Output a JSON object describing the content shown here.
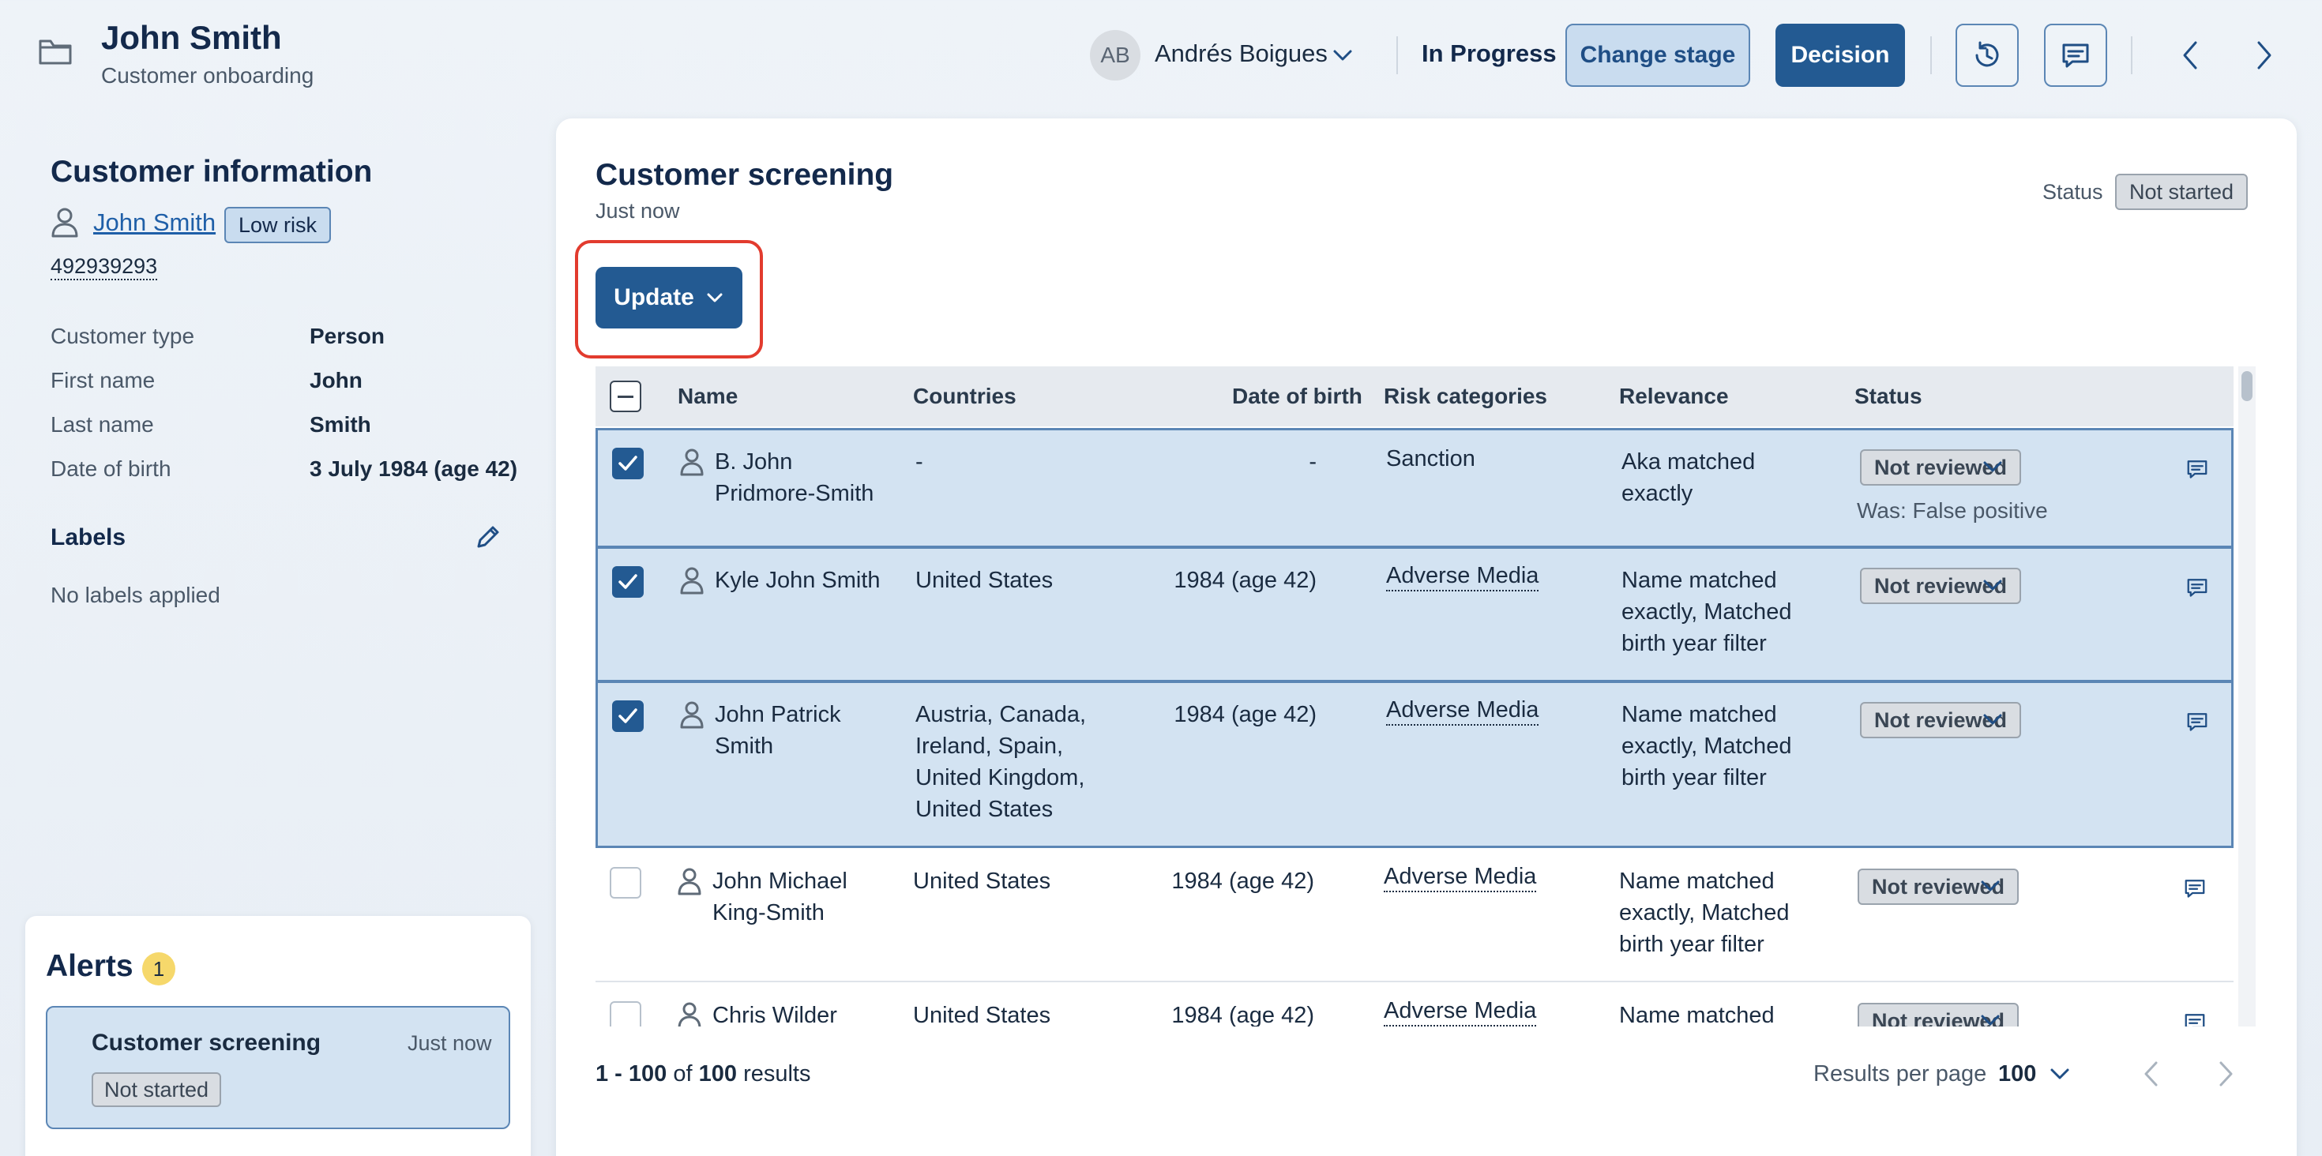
{
  "header": {
    "title": "John Smith",
    "subtitle": "Customer onboarding",
    "assignee_initials": "AB",
    "assignee_name": "Andrés Boigues",
    "stage": "In Progress",
    "change_stage_label": "Change stage",
    "decision_label": "Decision"
  },
  "customer": {
    "section_title": "Customer information",
    "name": "John Smith",
    "risk": "Low risk",
    "id": "492939293",
    "fields": [
      {
        "label": "Customer type",
        "value": "Person"
      },
      {
        "label": "First name",
        "value": "John"
      },
      {
        "label": "Last name",
        "value": "Smith"
      },
      {
        "label": "Date of birth",
        "value": "3 July 1984 (age 42)"
      }
    ],
    "labels_title": "Labels",
    "labels_empty": "No labels applied"
  },
  "alerts": {
    "title": "Alerts",
    "count": "1",
    "item_title": "Customer screening",
    "item_time": "Just now",
    "item_status": "Not started"
  },
  "screening": {
    "title": "Customer screening",
    "time": "Just now",
    "status_label": "Status",
    "status_value": "Not started",
    "update_label": "Update"
  },
  "table": {
    "columns": {
      "name": "Name",
      "countries": "Countries",
      "dob": "Date of birth",
      "risk": "Risk categories",
      "relevance": "Relevance",
      "status": "Status"
    },
    "rows": [
      {
        "name1": "B. John",
        "name2": "Pridmore-Smith",
        "countries": [
          "-"
        ],
        "dob": "-",
        "risk": "Sanction",
        "relevance": [
          "Aka matched",
          "exactly"
        ],
        "status": "Not reviewed",
        "was": "Was: False positive"
      },
      {
        "name1": "Kyle John Smith",
        "name2": "",
        "countries": [
          "United States"
        ],
        "dob": "1984 (age 42)",
        "risk": "Adverse Media",
        "relevance": [
          "Name matched",
          "exactly, Matched",
          "birth year filter"
        ],
        "status": "Not reviewed",
        "was": ""
      },
      {
        "name1": "John Patrick",
        "name2": "Smith",
        "countries": [
          "Austria, Canada,",
          "Ireland, Spain,",
          "United Kingdom,",
          "United States"
        ],
        "dob": "1984 (age 42)",
        "risk": "Adverse Media",
        "relevance": [
          "Name matched",
          "exactly, Matched",
          "birth year filter"
        ],
        "status": "Not reviewed",
        "was": ""
      },
      {
        "name1": "John Michael",
        "name2": "King-Smith",
        "countries": [
          "United States"
        ],
        "dob": "1984 (age 42)",
        "risk": "Adverse Media",
        "relevance": [
          "Name matched",
          "exactly, Matched",
          "birth year filter"
        ],
        "status": "Not reviewed",
        "was": ""
      },
      {
        "name1": "Chris Wilder",
        "name2": "",
        "countries": [
          "United States"
        ],
        "dob": "1984 (age 42)",
        "risk": "Adverse Media",
        "relevance": [
          "Name matched"
        ],
        "status": "Not reviewed",
        "was": ""
      }
    ]
  },
  "footer": {
    "range": "1 - 100",
    "of": "of",
    "total": "100",
    "results": "results",
    "per_page_label": "Results per page",
    "per_page_value": "100"
  },
  "icons": {
    "folder": "folder-icon",
    "history": "history-icon",
    "comment": "comment-icon",
    "person": "person-icon",
    "pencil": "pencil-icon"
  },
  "colors": {
    "primary": "#235a92",
    "highlight": "#e23b2e",
    "selected_row": "#d3e3f2",
    "alert_badge": "#f6d86b"
  }
}
